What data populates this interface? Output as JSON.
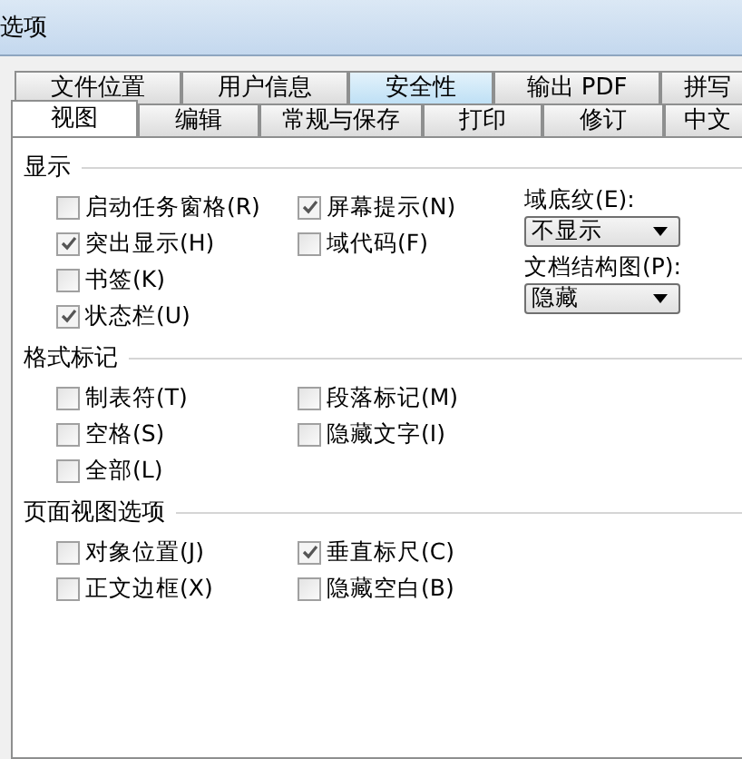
{
  "window": {
    "title": "选项"
  },
  "tabs_back": [
    {
      "label": "文件位置",
      "selected": false
    },
    {
      "label": "用户信息",
      "selected": false
    },
    {
      "label": "安全性",
      "selected": true
    },
    {
      "label": "输出 PDF",
      "selected": false
    },
    {
      "label": "拼写",
      "selected": false
    }
  ],
  "tabs_front": [
    {
      "label": "视图",
      "selected": true
    },
    {
      "label": "编辑",
      "selected": false
    },
    {
      "label": "常规与保存",
      "selected": false
    },
    {
      "label": "打印",
      "selected": false
    },
    {
      "label": "修订",
      "selected": false
    },
    {
      "label": "中文",
      "selected": false
    }
  ],
  "sections": [
    {
      "title": "显示",
      "columns": [
        [
          {
            "label": "启动任务窗格(R)",
            "checked": false
          },
          {
            "label": "突出显示(H)",
            "checked": true
          },
          {
            "label": "书签(K)",
            "checked": false
          },
          {
            "label": "状态栏(U)",
            "checked": true
          }
        ],
        [
          {
            "label": "屏幕提示(N)",
            "checked": true
          },
          {
            "label": "域代码(F)",
            "checked": false
          }
        ]
      ],
      "dropdowns": [
        {
          "label": "域底纹(E):",
          "value": "不显示"
        },
        {
          "label": "文档结构图(P):",
          "value": "隐藏"
        }
      ]
    },
    {
      "title": "格式标记",
      "columns": [
        [
          {
            "label": "制表符(T)",
            "checked": false
          },
          {
            "label": "空格(S)",
            "checked": false
          },
          {
            "label": "全部(L)",
            "checked": false
          }
        ],
        [
          {
            "label": "段落标记(M)",
            "checked": false
          },
          {
            "label": "隐藏文字(I)",
            "checked": false
          }
        ]
      ]
    },
    {
      "title": "页面视图选项",
      "columns": [
        [
          {
            "label": "对象位置(J)",
            "checked": false
          },
          {
            "label": "正文边框(X)",
            "checked": false
          }
        ],
        [
          {
            "label": "垂直标尺(C)",
            "checked": true
          },
          {
            "label": "隐藏空白(B)",
            "checked": false
          }
        ]
      ]
    }
  ]
}
